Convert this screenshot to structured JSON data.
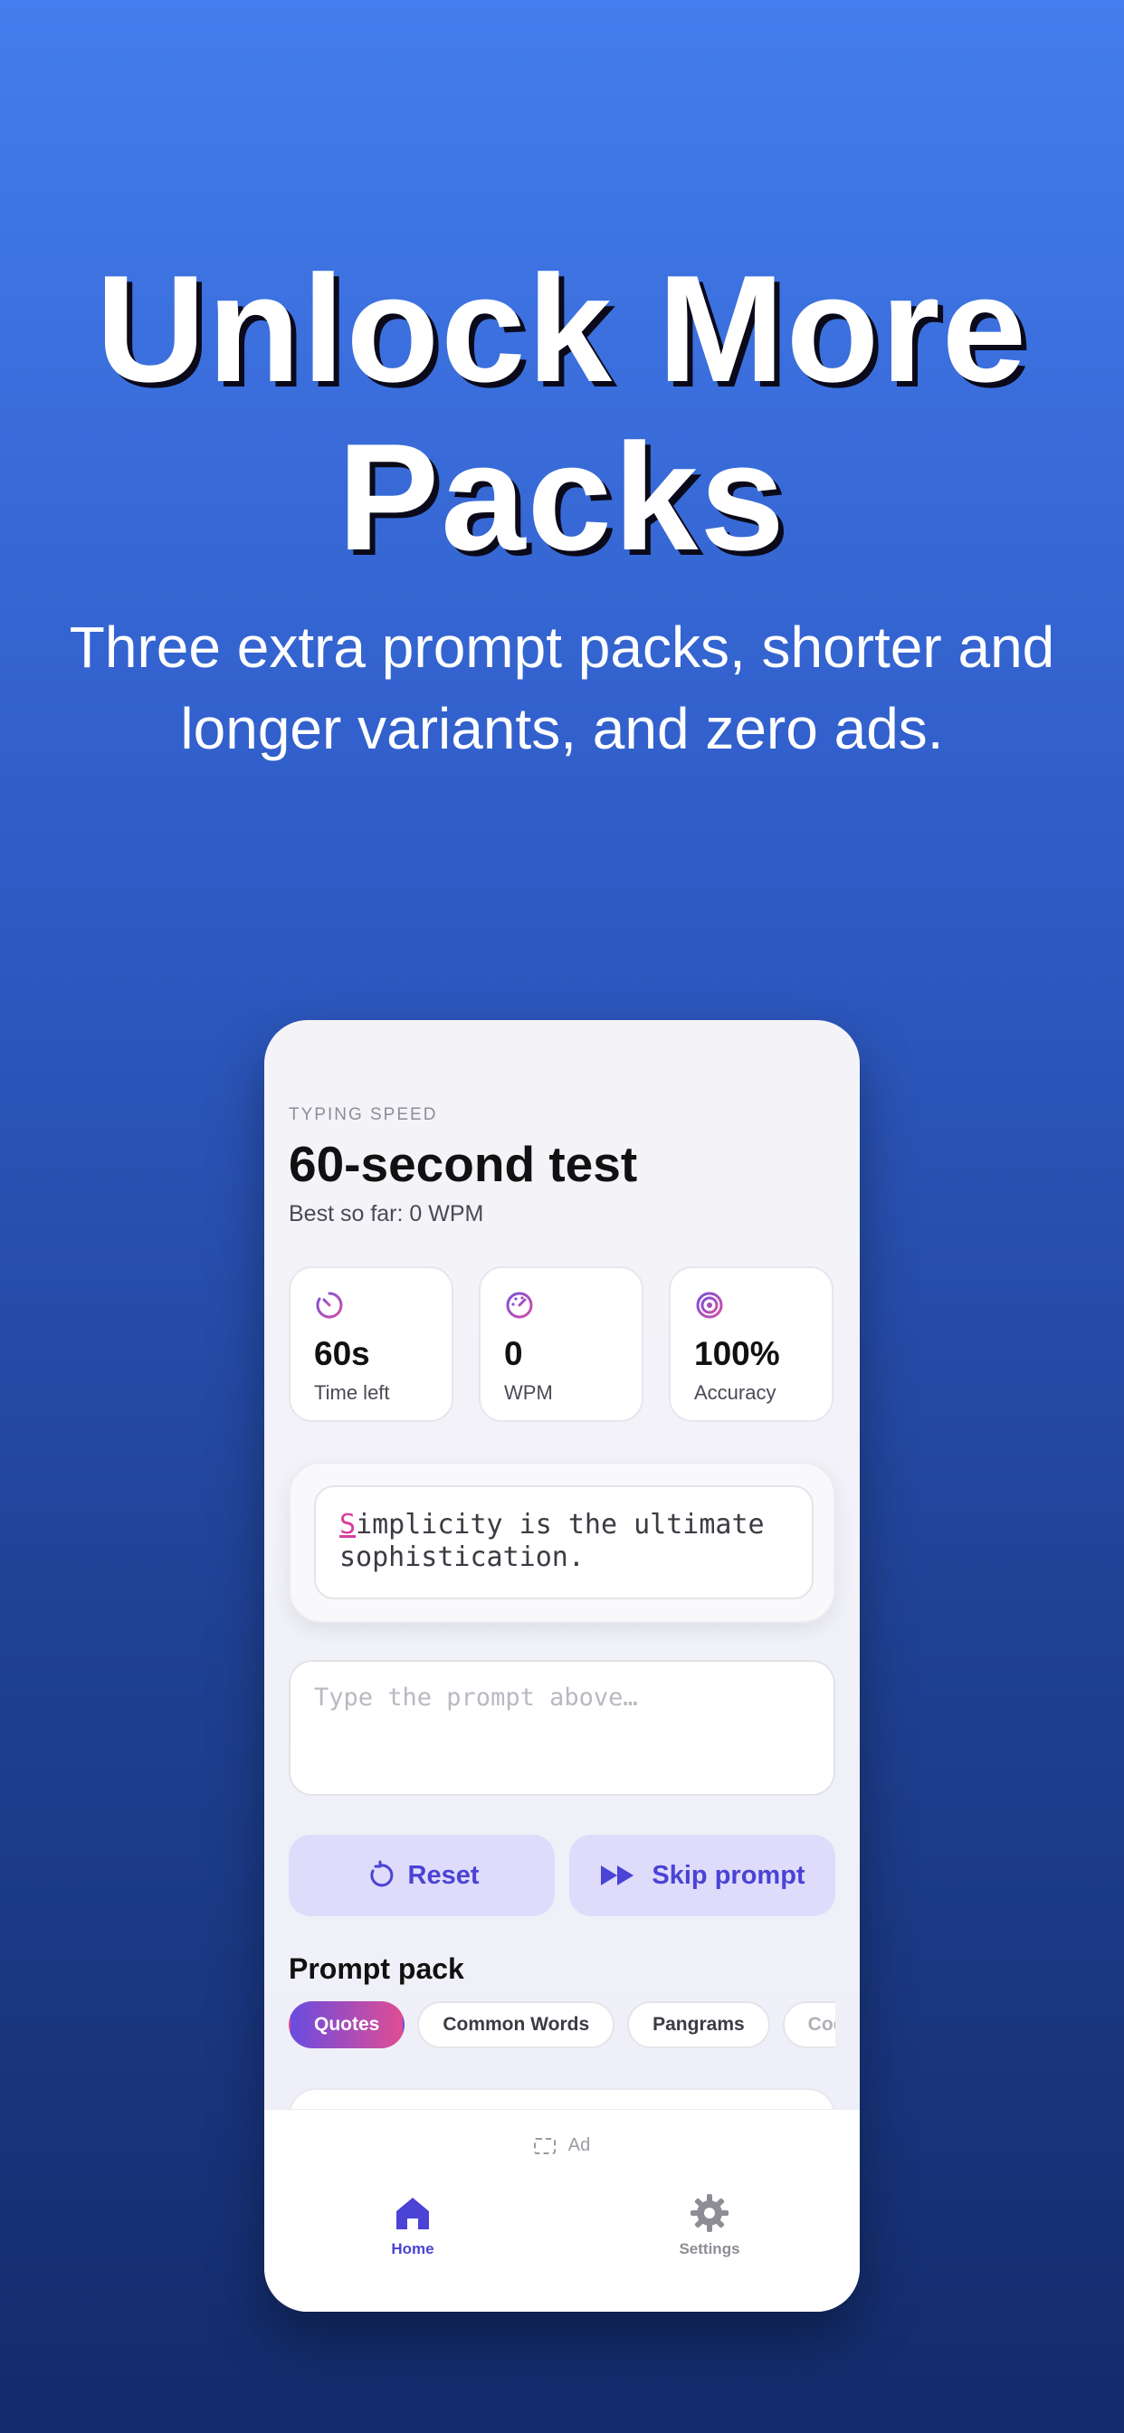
{
  "headline": "Unlock More Packs",
  "subhead": "Three extra prompt packs, shorter and longer variants, and zero ads.",
  "app": {
    "eyebrow": "TYPING SPEED",
    "title": "60-second test",
    "best": "Best so far: 0 WPM",
    "stats": [
      {
        "value": "60s",
        "label": "Time left",
        "icon": "timer-icon"
      },
      {
        "value": "0",
        "label": "WPM",
        "icon": "speedometer-icon"
      },
      {
        "value": "100%",
        "label": "Accuracy",
        "icon": "target-icon"
      }
    ],
    "prompt_first_char": "S",
    "prompt_rest": "implicity is the ultimate sophistication.",
    "input_placeholder": "Type the prompt above…",
    "reset_label": "Reset",
    "skip_label": "Skip prompt",
    "pack_label": "Prompt pack",
    "packs": [
      "Quotes",
      "Common Words",
      "Pangrams",
      "Code"
    ],
    "active_pack": "Quotes",
    "ad_label": "Ad",
    "tabs": {
      "home": "Home",
      "settings": "Settings"
    },
    "colors": {
      "accent": "#4b42d6",
      "gradient_start": "#6a4ce0",
      "gradient_end": "#e04d93",
      "cursor": "#d63ea0"
    }
  }
}
